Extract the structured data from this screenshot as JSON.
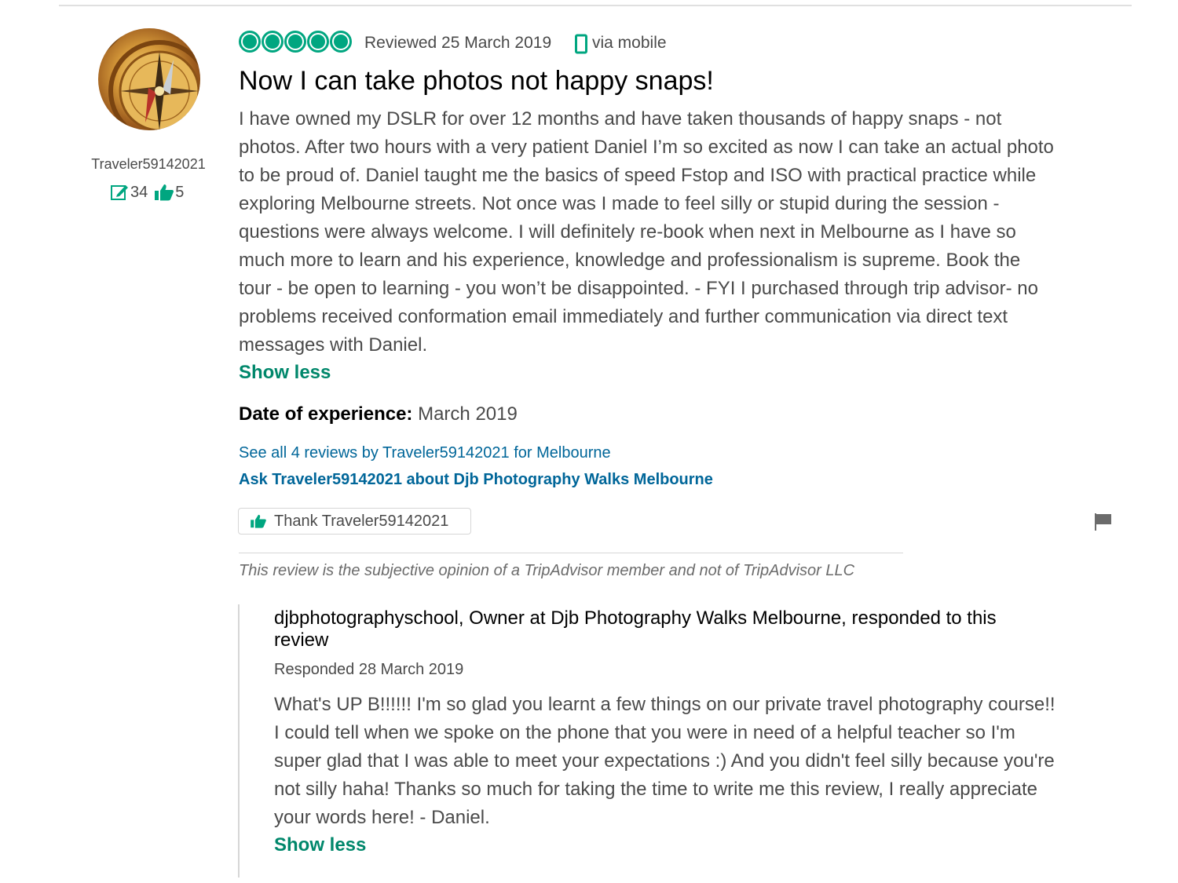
{
  "member": {
    "name": "Traveler59142021",
    "contributions": "34",
    "helpful_votes": "5"
  },
  "review": {
    "rating": 5,
    "rating_max": 5,
    "reviewed_date": "Reviewed 25 March 2019",
    "via": "via mobile",
    "title": "Now I can take photos not happy snaps!",
    "body": "I have owned my DSLR for over 12 months and have taken thousands of happy snaps - not photos. After two hours with a very patient Daniel I’m so excited as now I can take an actual photo to be proud of. Daniel taught me the basics of speed Fstop and ISO with practical practice while exploring Melbourne streets. Not once was I made to feel silly or stupid during the session - questions were always welcome. I will definitely re-book when next in Melbourne as I have so much more to learn and his experience, knowledge and professionalism is supreme. Book the tour - be open to learning - you won’t be disappointed. - FYI I purchased through trip advisor- no problems received conformation email immediately and further communication via direct text messages with Daniel.",
    "show_less": "Show less",
    "date_of_experience_label": "Date of experience:",
    "date_of_experience_value": "March 2019",
    "see_all_link": "See all 4 reviews by Traveler59142021 for Melbourne",
    "ask_link": "Ask Traveler59142021 about Djb Photography Walks Melbourne",
    "thank_button": "Thank Traveler59142021",
    "disclaimer": "This review is the subjective opinion of a TripAdvisor member and not of TripAdvisor LLC"
  },
  "response": {
    "header": "djbphotographyschool, Owner at Djb Photography Walks Melbourne, responded to this review",
    "date": "Responded 28 March 2019",
    "body": "What's UP B!!!!!! I'm so glad you learnt a few things on our private travel photography course!! I could tell when we spoke on the phone that you were in need of a helpful teacher so I'm super glad that I was able to meet your expectations :) And you didn't feel silly because you're not silly haha! Thanks so much for taking the time to write me this review, I really appreciate your words here! - Daniel.",
    "show_less": "Show less"
  },
  "colors": {
    "accent_green": "#00a680",
    "link_blue": "#006699",
    "show_less_green": "#00876b"
  },
  "icons": {
    "rating": "bubble-rating-icon",
    "mobile": "mobile-phone-icon",
    "contributions": "pencil-edit-icon",
    "helpful": "thumbs-up-icon",
    "flag": "flag-icon"
  }
}
